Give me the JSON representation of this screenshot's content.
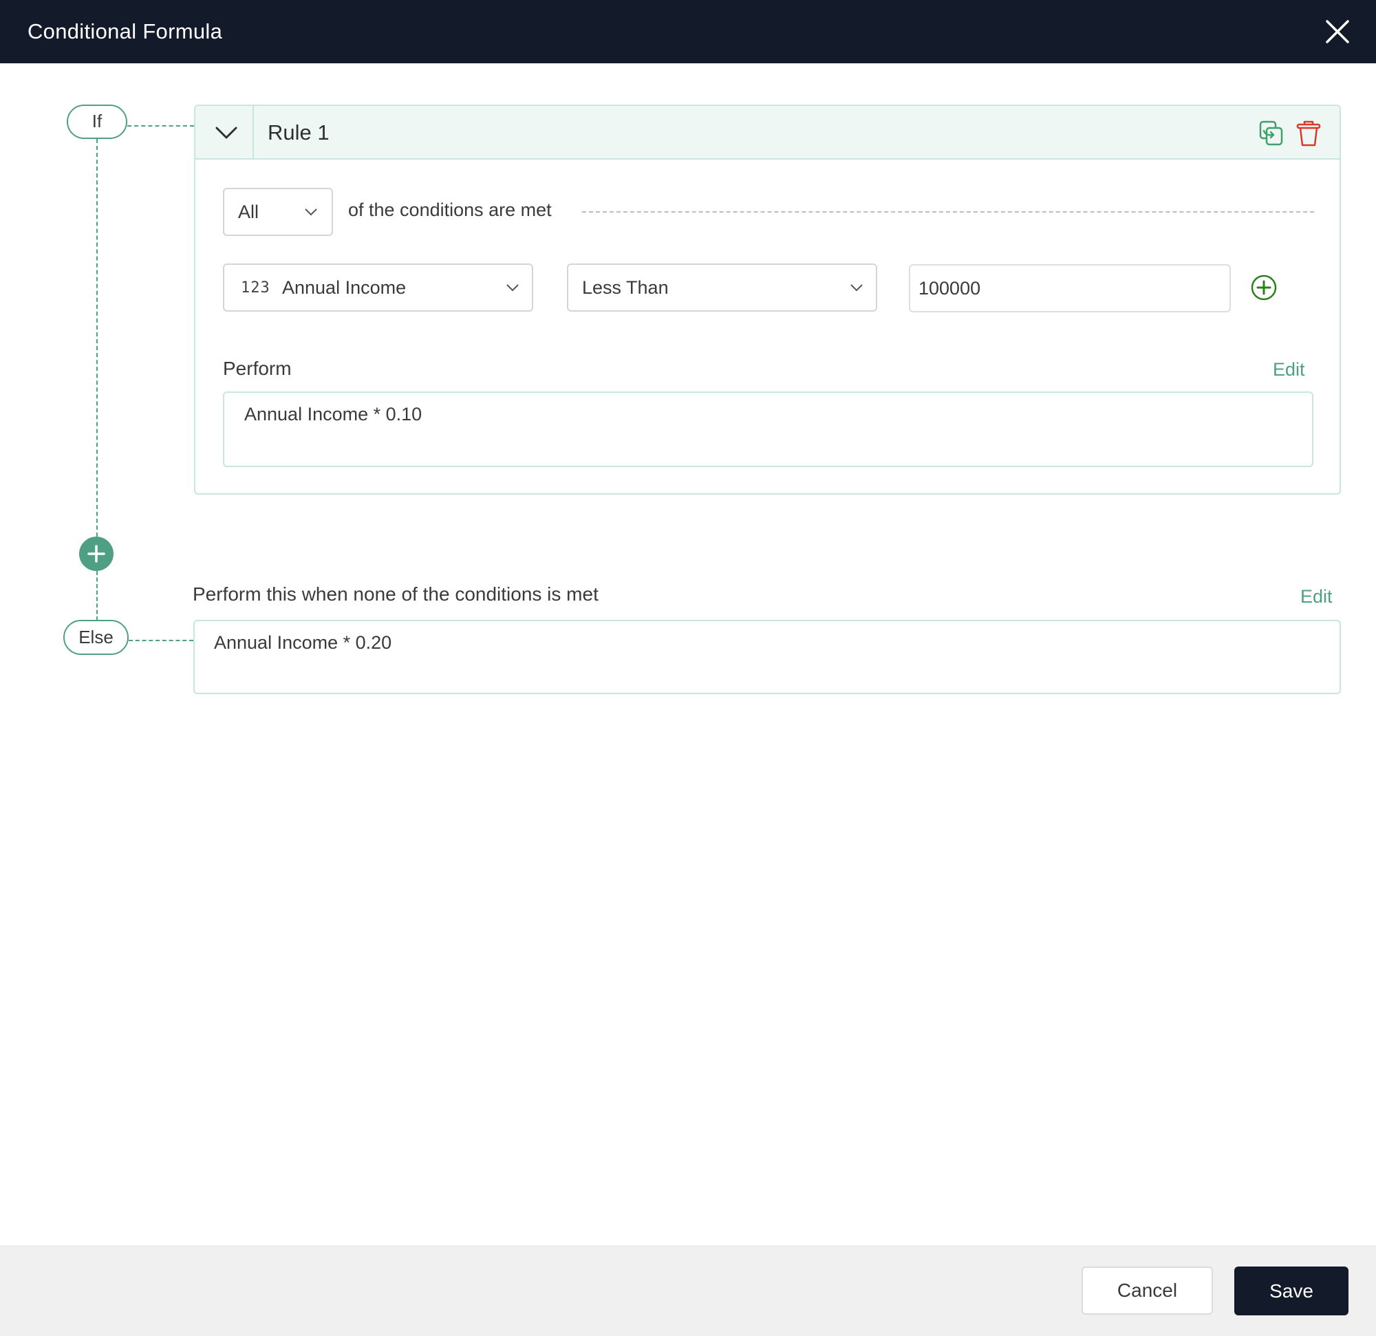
{
  "dialog": {
    "title": "Conditional Formula",
    "close_icon": "close-icon"
  },
  "flow": {
    "if_label": "If",
    "else_label": "Else",
    "add_rule_icon": "plus-icon"
  },
  "rules": [
    {
      "title": "Rule 1",
      "collapse_icon": "chevron-down-icon",
      "actions": {
        "duplicate_icon": "copy-icon",
        "delete_icon": "trash-icon"
      },
      "match": {
        "selected": "All",
        "suffix": "of the conditions are met"
      },
      "conditions": [
        {
          "field": {
            "type_icon": "123",
            "value": "Annual Income"
          },
          "operator": "Less Than",
          "value": "100000",
          "add_icon": "plus-circle-icon"
        }
      ],
      "perform": {
        "label": "Perform",
        "edit_label": "Edit",
        "formula": "Annual Income * 0.10"
      }
    }
  ],
  "else": {
    "label": "Perform this when none of the conditions is met",
    "edit_label": "Edit",
    "formula": "Annual Income * 0.20"
  },
  "footer": {
    "cancel_label": "Cancel",
    "save_label": "Save"
  },
  "colors": {
    "header_bg": "#131b2b",
    "accent": "#4f9f85",
    "delete": "#d8392b",
    "duplicate": "#3fa06a",
    "add_condition": "#2e7d1f"
  }
}
